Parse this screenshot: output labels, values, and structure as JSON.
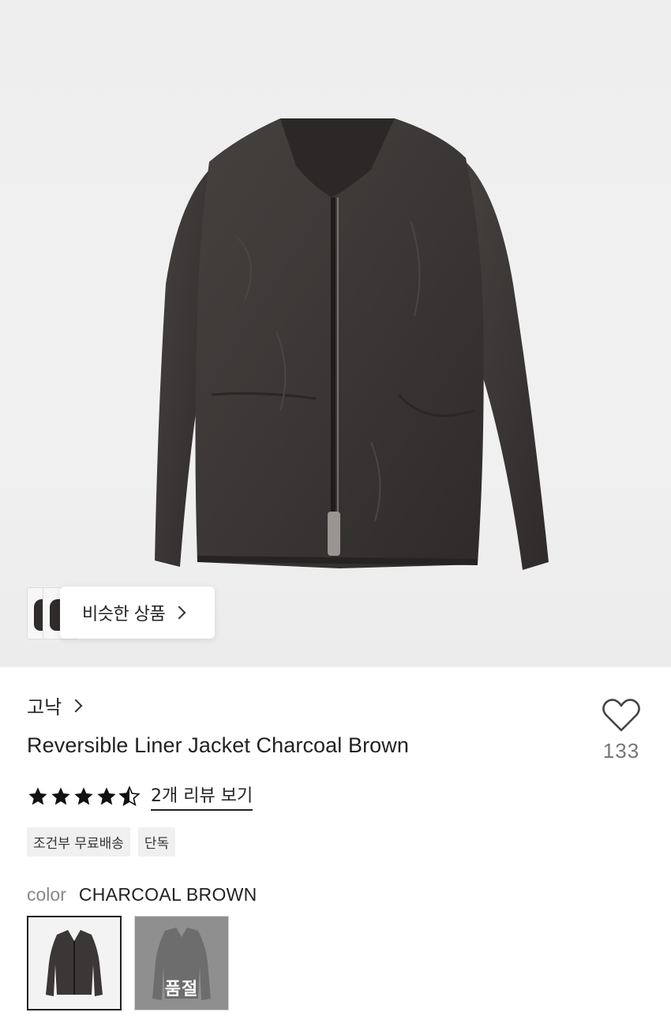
{
  "similar": {
    "label": "비슷한 상품"
  },
  "product": {
    "brand": "고낙",
    "title": "Reversible Liner Jacket Charcoal Brown",
    "like_count": "133",
    "rating": 4.5,
    "review_link": "2개 리뷰 보기",
    "badges": [
      "조건부 무료배송",
      "단독"
    ],
    "color_key": "color",
    "color_value": "CHARCOAL BROWN",
    "swatches": [
      {
        "name": "charcoal-brown",
        "selected": true,
        "status": ""
      },
      {
        "name": "grey",
        "selected": false,
        "status": "품절"
      }
    ]
  },
  "colors": {
    "jacket": "#3a3736",
    "background": "#eeeeee",
    "star": "#111111",
    "muted_text": "#888888"
  },
  "icons": [
    "heart-outline-icon",
    "chevron-right-icon",
    "star-icon"
  ]
}
